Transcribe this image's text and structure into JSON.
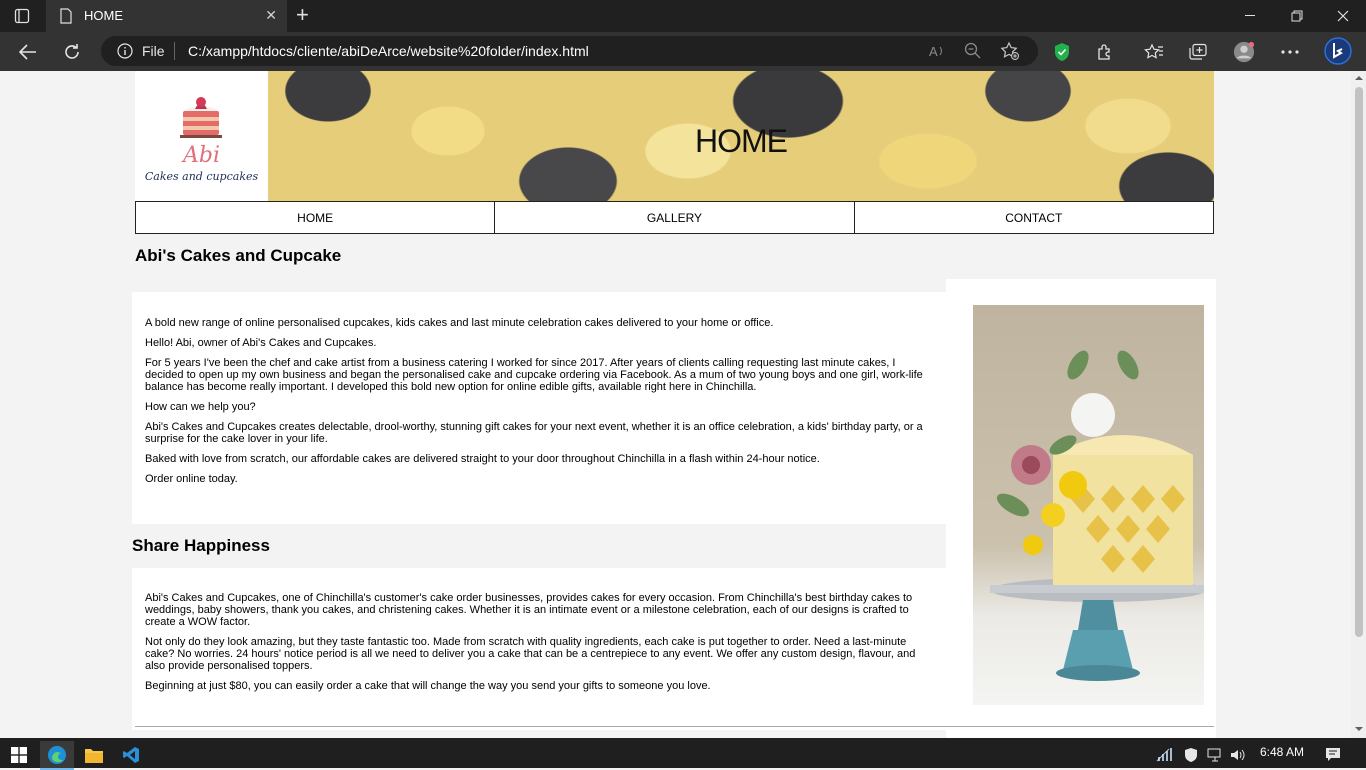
{
  "browser": {
    "tab_title": "HOME",
    "scheme_label": "File",
    "url": "C:/xampp/htdocs/cliente/abiDeArce/website%20folder/index.html"
  },
  "page": {
    "logo_name": "Abi",
    "logo_tagline": "Cakes and cupcakes",
    "banner_title": "HOME",
    "nav": [
      {
        "label": "HOME"
      },
      {
        "label": "GALLERY"
      },
      {
        "label": "CONTACT"
      }
    ],
    "site_title": "Abi's Cakes and Cupcake",
    "main_paragraphs": [
      "A bold new range of online personalised cupcakes, kids cakes and last minute celebration cakes delivered to your home or office.",
      "Hello! Abi, owner of Abi's Cakes and Cupcakes.",
      "For 5 years I've been the chef and cake artist from a business catering I worked for since 2017. After years of clients calling requesting last minute cakes, I decided to open up my own business and began the personalised cake and cupcake ordering via Facebook. As a mum of two young boys and one girl, work-life balance has become really important. I developed this bold new option for online edible gifts, available right here in Chinchilla.",
      "How can we help you?",
      "Abi's Cakes and Cupcakes creates delectable, drool-worthy, stunning gift cakes for your next event, whether it is an office celebration, a kids' birthday party, or a surprise for the cake lover in your life.",
      "Baked with love from scratch, our affordable cakes are delivered straight to your door throughout Chinchilla in a flash within 24-hour notice.",
      "Order online today."
    ],
    "section_title": "Share Happiness",
    "section_paragraphs": [
      "Abi's Cakes and Cupcakes, one of Chinchilla's customer's cake order businesses, provides cakes for every occasion. From Chinchilla's best birthday cakes to weddings, baby showers, thank you cakes, and christening cakes. Whether it is an intimate event or a milestone celebration, each of our designs is crafted to create a WOW factor.",
      "Not only do they look amazing, but they taste fantastic too. Made from scratch with quality ingredients, each cake is put together to order. Need a last-minute cake? No worries. 24 hours' notice period is all we need to deliver you a cake that can be a centrepiece to any event. We offer any custom design, flavour, and also provide personalised toppers.",
      "Beginning at just $80, you can easily order a cake that will change the way you send your gifts to someone you love."
    ]
  },
  "taskbar": {
    "clock": "6:48 AM"
  },
  "colors": {
    "chrome_dark": "#202020",
    "toolbar": "#333333",
    "page_bg": "#f3f3f3",
    "logo_pink": "#e0707a",
    "logo_navy": "#1e2f55",
    "shield_green": "#22b14c",
    "bing_blue": "#2a6fdb"
  }
}
